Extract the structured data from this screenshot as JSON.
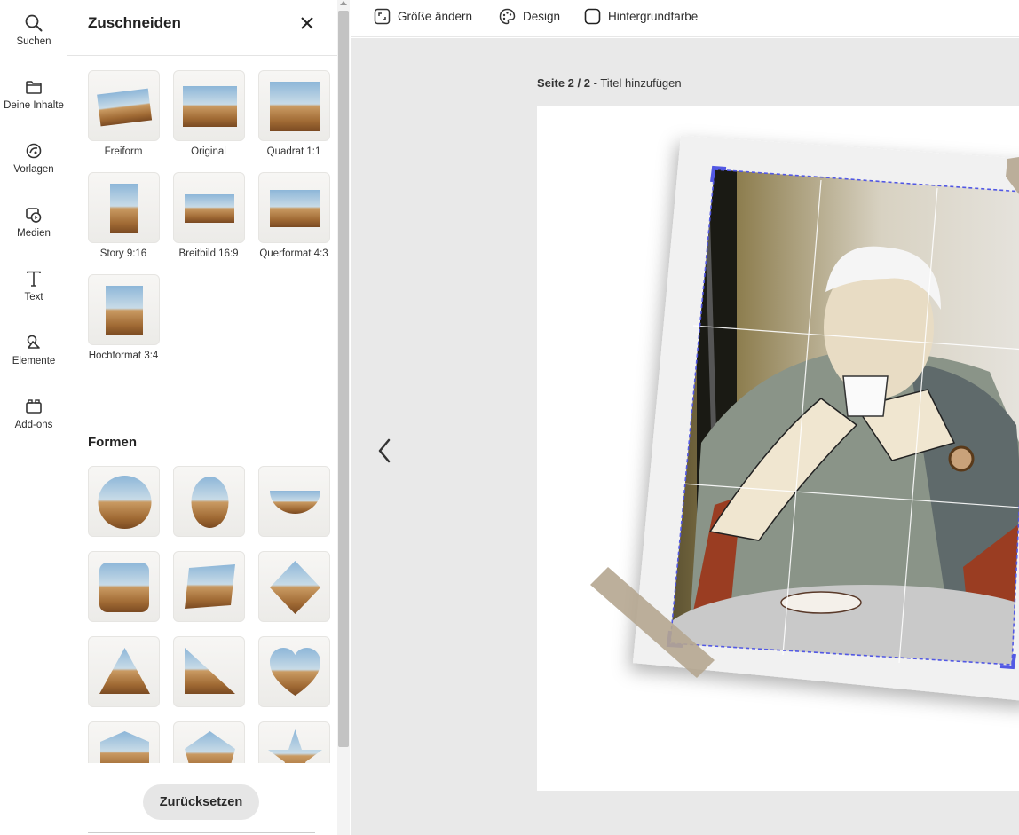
{
  "rail": {
    "items": [
      {
        "label": "Suchen",
        "icon": "search-icon"
      },
      {
        "label": "Deine Inhalte",
        "icon": "folder-icon"
      },
      {
        "label": "Vorlagen",
        "icon": "templates-icon"
      },
      {
        "label": "Medien",
        "icon": "media-icon"
      },
      {
        "label": "Text",
        "icon": "text-icon"
      },
      {
        "label": "Elemente",
        "icon": "elements-icon"
      },
      {
        "label": "Add-ons",
        "icon": "addons-icon"
      }
    ]
  },
  "panel": {
    "title": "Zuschneiden",
    "close_icon": "close-icon",
    "crop_options": [
      {
        "label": "Freiform"
      },
      {
        "label": "Original"
      },
      {
        "label": "Quadrat 1:1"
      },
      {
        "label": "Story 9:16"
      },
      {
        "label": "Breitbild 16:9"
      },
      {
        "label": "Querformat 4:3"
      },
      {
        "label": "Hochformat 3:4"
      }
    ],
    "shapes_title": "Formen",
    "shapes": [
      "circle",
      "ellipse",
      "half-circle",
      "rounded-square",
      "parallelogram",
      "diamond",
      "triangle",
      "right-triangle",
      "heart",
      "pentagon",
      "hexagon",
      "star"
    ],
    "reset_label": "Zurücksetzen"
  },
  "toolbar": {
    "resize_label": "Größe ändern",
    "design_label": "Design",
    "background_label": "Hintergrundfarbe"
  },
  "canvas": {
    "page_prefix": "Seite 2 / 2",
    "page_separator": " - ",
    "title_placeholder": "Titel hinzufügen"
  },
  "colors": {
    "accent": "#5258e4",
    "panel_bg": "#ffffff",
    "canvas_bg": "#e9e9e9",
    "button_bg": "#e6e6e6"
  }
}
